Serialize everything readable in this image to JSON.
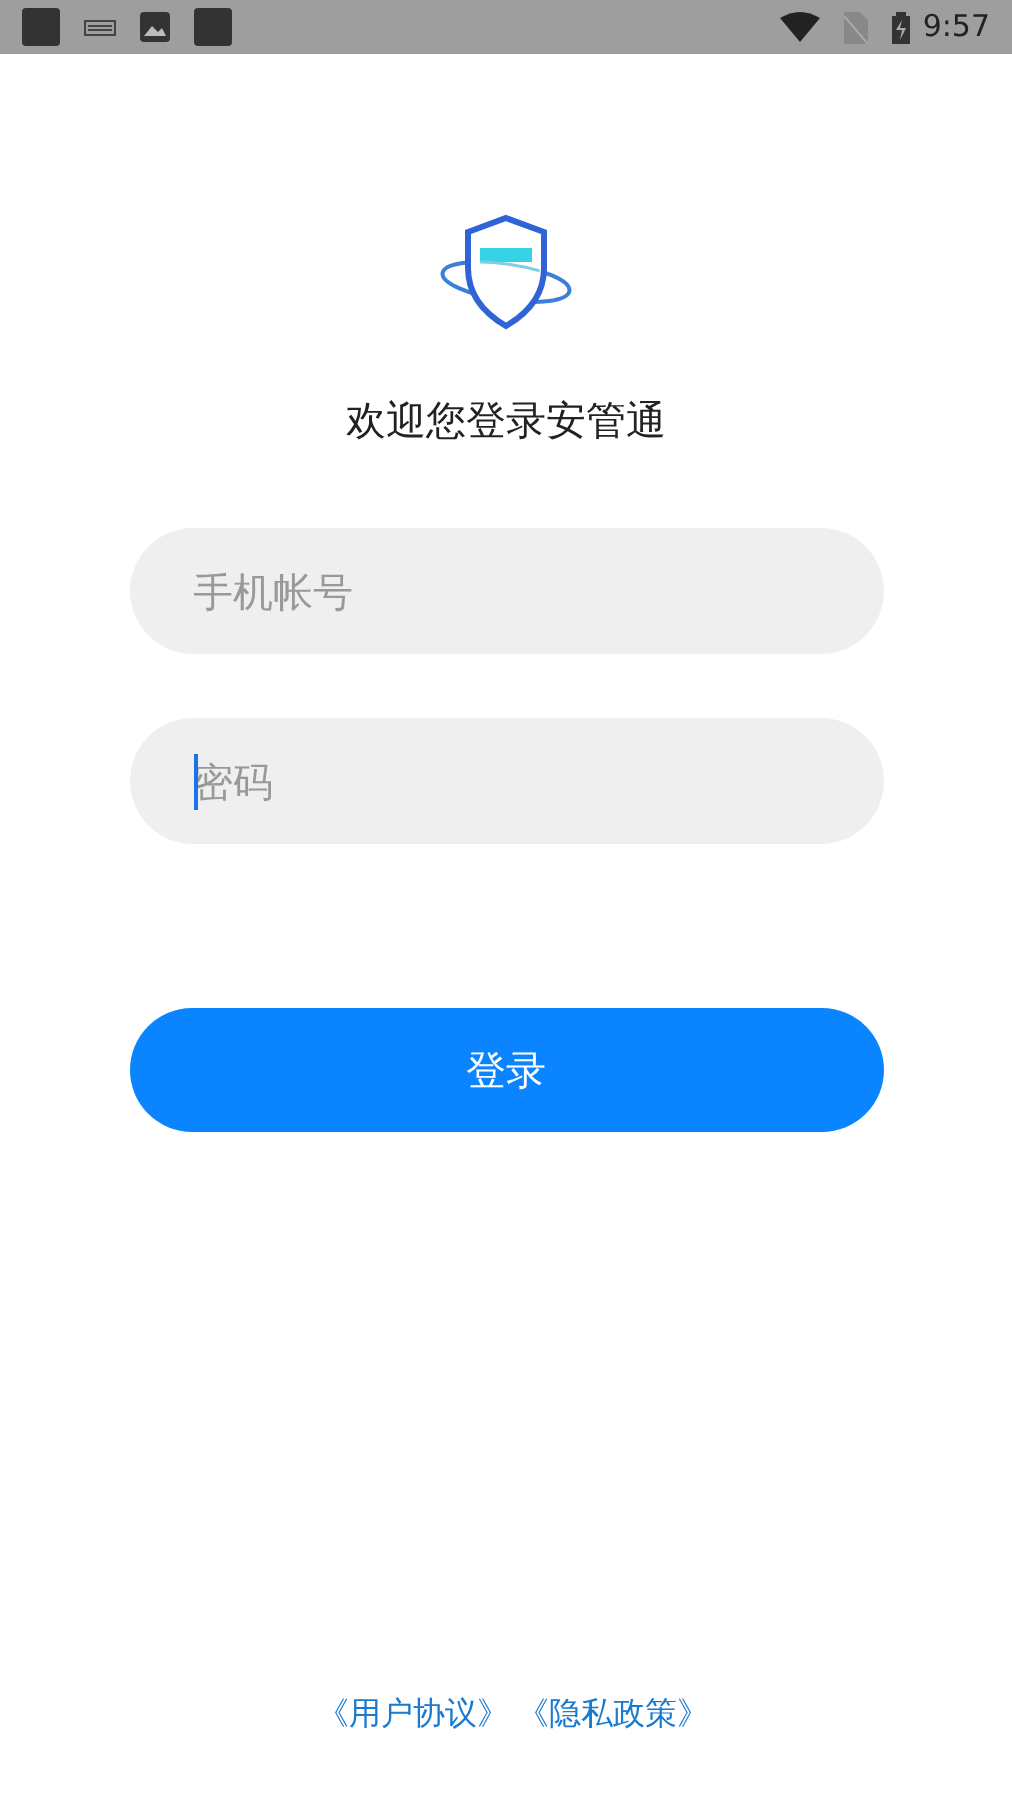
{
  "status_bar": {
    "time": "9:57"
  },
  "welcome": "欢迎您登录安管通",
  "fields": [
    {
      "placeholder": "手机帐号",
      "focused": false
    },
    {
      "placeholder": "密码",
      "focused": true
    }
  ],
  "login_button": "登录",
  "links": [
    "《用户协议》",
    "《隐私政策》"
  ]
}
